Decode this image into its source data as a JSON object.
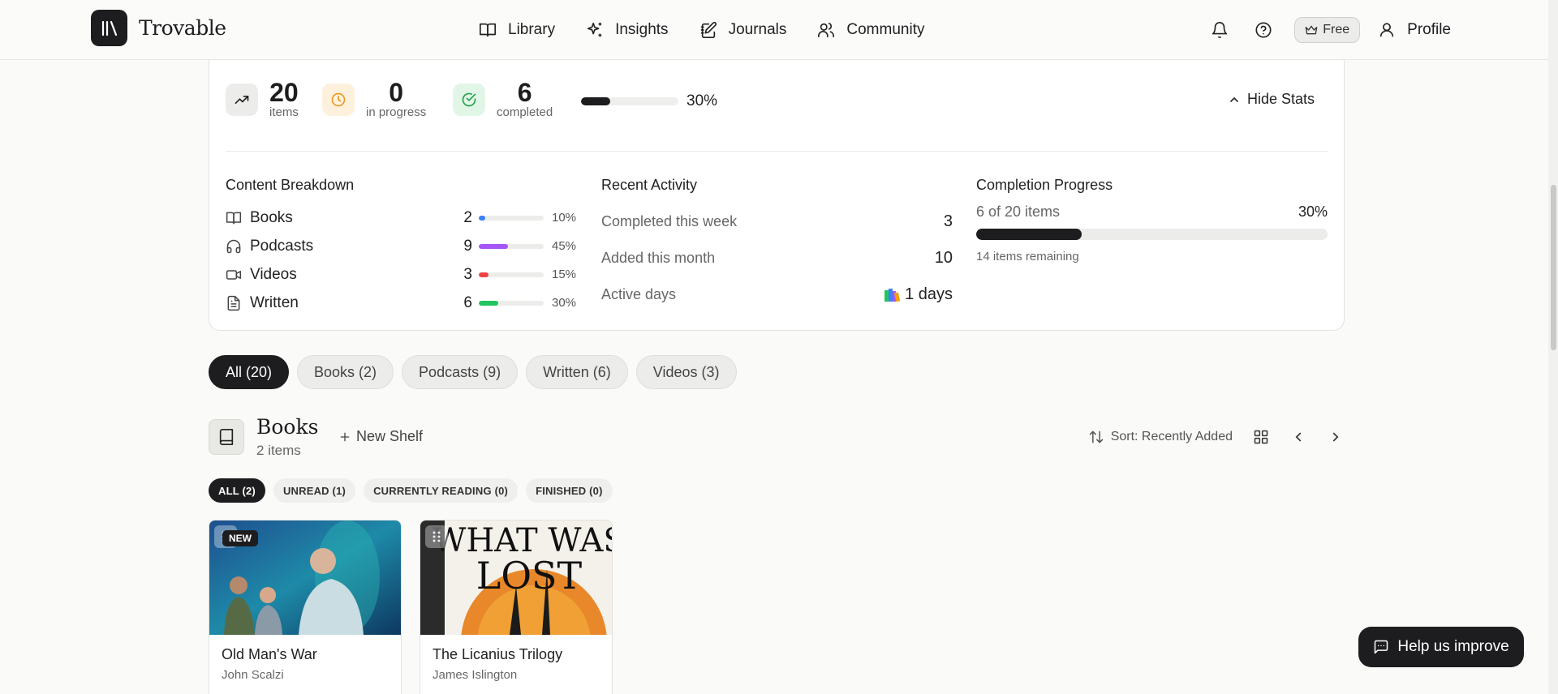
{
  "brand": {
    "name": "Trovable"
  },
  "nav": {
    "links": [
      {
        "label": "Library",
        "icon": "book-open-icon"
      },
      {
        "label": "Insights",
        "icon": "sparkles-icon"
      },
      {
        "label": "Journals",
        "icon": "notebook-pen-icon"
      },
      {
        "label": "Community",
        "icon": "users-icon"
      }
    ],
    "plan_label": "Free",
    "profile_label": "Profile"
  },
  "stats": {
    "items": {
      "value": "20",
      "label": "items"
    },
    "in_progress": {
      "value": "0",
      "label": "in progress"
    },
    "completed": {
      "value": "6",
      "label": "completed"
    },
    "completion_fraction": 0.3,
    "completion_label": "30%",
    "hide_label": "Hide Stats"
  },
  "breakdown": {
    "title": "Content Breakdown",
    "rows": [
      {
        "name": "Books",
        "count": "2",
        "pct": "10%",
        "fraction": 0.1,
        "color": "#3b82f6",
        "icon": "book-icon"
      },
      {
        "name": "Podcasts",
        "count": "9",
        "pct": "45%",
        "fraction": 0.45,
        "color": "#a855f7",
        "icon": "headphones-icon"
      },
      {
        "name": "Videos",
        "count": "3",
        "pct": "15%",
        "fraction": 0.15,
        "color": "#ef4444",
        "icon": "video-icon"
      },
      {
        "name": "Written",
        "count": "6",
        "pct": "30%",
        "fraction": 0.3,
        "color": "#22c55e",
        "icon": "file-text-icon"
      }
    ]
  },
  "activity": {
    "title": "Recent Activity",
    "completed_week_label": "Completed this week",
    "completed_week_value": "3",
    "added_month_label": "Added this month",
    "added_month_value": "10",
    "active_days_label": "Active days",
    "active_days_value": "1 days"
  },
  "completion": {
    "title": "Completion Progress",
    "summary": "6 of 20 items",
    "pct": "30%",
    "fraction": 0.3,
    "remaining": "14 items remaining"
  },
  "filters": [
    "All (20)",
    "Books (2)",
    "Podcasts (9)",
    "Written (6)",
    "Videos (3)"
  ],
  "shelf": {
    "title": "Books",
    "count": "2 items",
    "new_shelf_label": "New Shelf",
    "sort_label": "Sort: Recently Added"
  },
  "status_tabs": [
    "ALL (2)",
    "UNREAD (1)",
    "CURRENTLY READING (0)",
    "FINISHED (0)"
  ],
  "books": [
    {
      "title": "Old Man's War",
      "author": "John Scalzi",
      "badge": "NEW"
    },
    {
      "title": "The Licanius Trilogy",
      "author": "James Islington",
      "cover_text": "WHAT WAS LOST"
    }
  ],
  "help_label": "Help us improve"
}
